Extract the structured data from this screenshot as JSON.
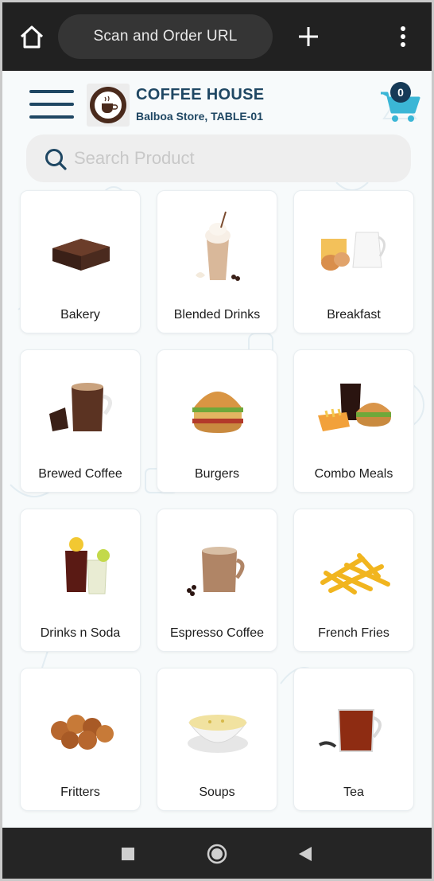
{
  "browser": {
    "url_text": "Scan and Order URL",
    "icons": [
      "home-icon",
      "plus-icon",
      "more-vert-icon"
    ]
  },
  "header": {
    "store_name": "COFFEE HOUSE",
    "store_subtitle": "Balboa Store, TABLE-01",
    "logo_text": "COFFEE HOUSE",
    "cart_count": "0",
    "colors": {
      "brand": "#1f4763",
      "cart": "#3bb6d6",
      "badge": "#163a57"
    }
  },
  "search": {
    "placeholder": "Search Product",
    "value": ""
  },
  "categories": [
    {
      "label": "Bakery",
      "icon": "brownie-icon"
    },
    {
      "label": "Blended Drinks",
      "icon": "frappe-icon"
    },
    {
      "label": "Breakfast",
      "icon": "milk-eggs-icon"
    },
    {
      "label": "Brewed Coffee",
      "icon": "coffee-mug-icon"
    },
    {
      "label": "Burgers",
      "icon": "burger-icon"
    },
    {
      "label": "Combo Meals",
      "icon": "combo-meal-icon"
    },
    {
      "label": "Drinks n Soda",
      "icon": "soda-glasses-icon"
    },
    {
      "label": "Espresso Coffee",
      "icon": "espresso-mug-icon"
    },
    {
      "label": "French Fries",
      "icon": "fries-icon"
    },
    {
      "label": "Fritters",
      "icon": "fritters-icon"
    },
    {
      "label": "Soups",
      "icon": "soup-bowl-icon"
    },
    {
      "label": "Tea",
      "icon": "tea-mug-icon"
    }
  ],
  "nav": {
    "icons": [
      "recents-square-icon",
      "home-circle-icon",
      "back-triangle-icon"
    ]
  }
}
